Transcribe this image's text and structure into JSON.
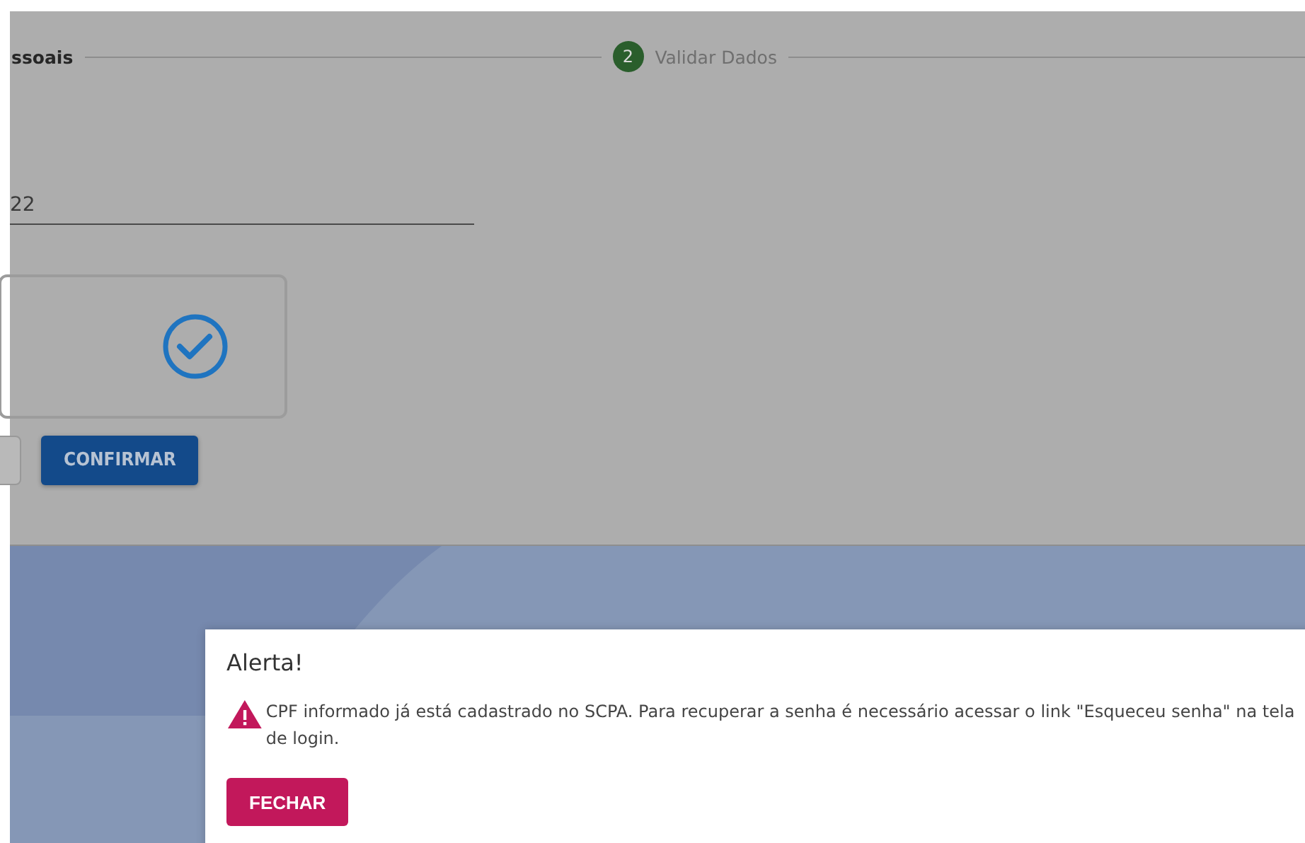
{
  "stepper": {
    "current_step_label": "ssoais",
    "next_step": {
      "number": "2",
      "label": "Validar Dados"
    }
  },
  "form": {
    "field_value": "22",
    "buttons": [
      "CONFIRMAR"
    ]
  },
  "dialog": {
    "title": "Alerta!",
    "message": "CPF informado já está cadastrado no SCPA. Para recuperar a senha é necessário acessar o link \"Esqueceu senha\" na tela de login.",
    "button": "FECHAR"
  }
}
